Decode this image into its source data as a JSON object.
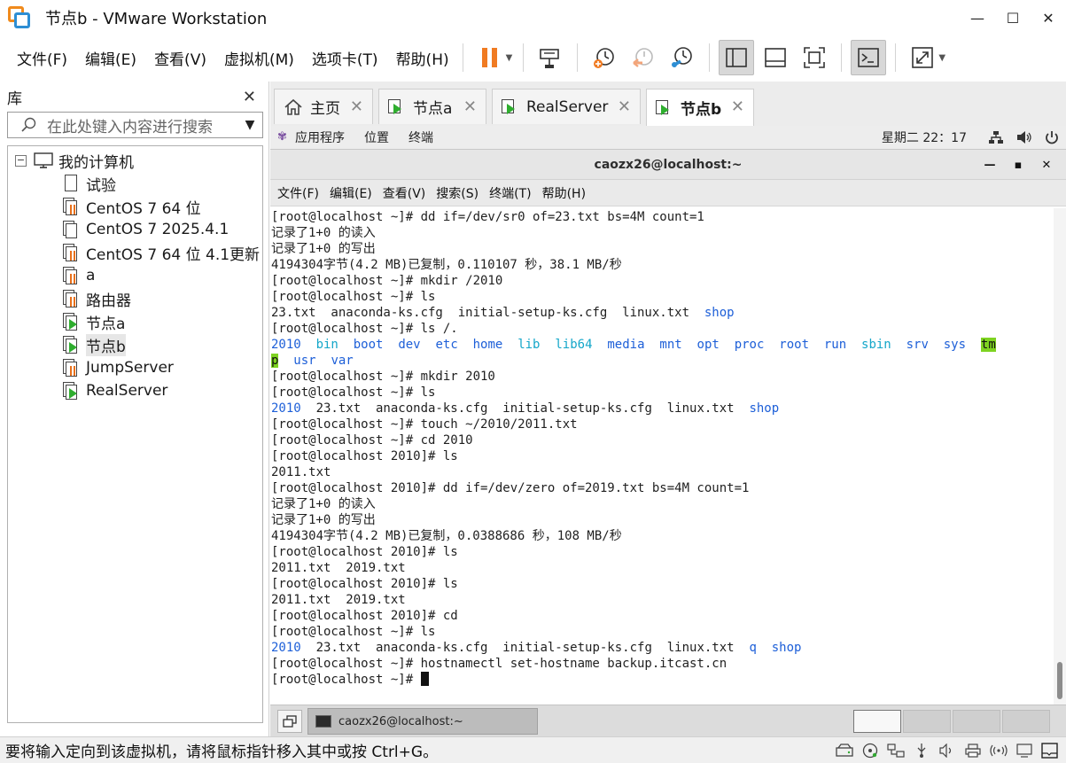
{
  "window": {
    "title": "节点b - VMware Workstation"
  },
  "menu": [
    "文件(F)",
    "编辑(E)",
    "查看(V)",
    "虚拟机(M)",
    "选项卡(T)",
    "帮助(H)"
  ],
  "library": {
    "title": "库",
    "search_placeholder": "在此处键入内容进行搜索",
    "root": "我的计算机",
    "items": [
      {
        "label": "试验",
        "icon": "document-icon"
      },
      {
        "label": "CentOS 7 64 位",
        "icon": "vm-suspended-icon"
      },
      {
        "label": "CentOS 7 2025.4.1",
        "icon": "vm-icon"
      },
      {
        "label": "CentOS 7 64 位 4.1更新",
        "icon": "vm-suspended-icon"
      },
      {
        "label": "a",
        "icon": "vm-suspended-icon"
      },
      {
        "label": "路由器",
        "icon": "vm-suspended-icon"
      },
      {
        "label": "节点a",
        "icon": "vm-running-icon"
      },
      {
        "label": "节点b",
        "icon": "vm-running-icon",
        "selected": true
      },
      {
        "label": "JumpServer",
        "icon": "vm-suspended-icon"
      },
      {
        "label": "RealServer",
        "icon": "vm-running-icon"
      }
    ]
  },
  "tabs": [
    {
      "label": "主页",
      "icon": "home-icon"
    },
    {
      "label": "节点a",
      "icon": "vm-running-icon"
    },
    {
      "label": "RealServer",
      "icon": "vm-running-icon"
    },
    {
      "label": "节点b",
      "icon": "vm-running-icon",
      "active": true
    }
  ],
  "gnome": {
    "apps": "应用程序",
    "places": "位置",
    "terminal": "终端",
    "clock": "星期二 22：17"
  },
  "terminal": {
    "title": "caozx26@localhost:~",
    "menu": [
      "文件(F)",
      "编辑(E)",
      "查看(V)",
      "搜索(S)",
      "终端(T)",
      "帮助(H)"
    ],
    "lines": [
      [
        {
          "t": "[root@localhost ~]# dd if=/dev/sr0 of=23.txt bs=4M count=1"
        }
      ],
      [
        {
          "t": "记录了1+0 的读入"
        }
      ],
      [
        {
          "t": "记录了1+0 的写出"
        }
      ],
      [
        {
          "t": "4194304字节(4.2 MB)已复制，0.110107 秒，38.1 MB/秒"
        }
      ],
      [
        {
          "t": "[root@localhost ~]# mkdir /2010"
        }
      ],
      [
        {
          "t": "[root@localhost ~]# ls"
        }
      ],
      [
        {
          "t": "23.txt  anaconda-ks.cfg  initial-setup-ks.cfg  linux.txt  "
        },
        {
          "t": "shop",
          "c": "blue"
        }
      ],
      [
        {
          "t": "[root@localhost ~]# ls /."
        }
      ],
      [
        {
          "t": "2010",
          "c": "blue"
        },
        {
          "t": "  "
        },
        {
          "t": "bin",
          "c": "cyan"
        },
        {
          "t": "  "
        },
        {
          "t": "boot",
          "c": "blue"
        },
        {
          "t": "  "
        },
        {
          "t": "dev",
          "c": "blue"
        },
        {
          "t": "  "
        },
        {
          "t": "etc",
          "c": "blue"
        },
        {
          "t": "  "
        },
        {
          "t": "home",
          "c": "blue"
        },
        {
          "t": "  "
        },
        {
          "t": "lib",
          "c": "cyan"
        },
        {
          "t": "  "
        },
        {
          "t": "lib64",
          "c": "cyan"
        },
        {
          "t": "  "
        },
        {
          "t": "media",
          "c": "blue"
        },
        {
          "t": "  "
        },
        {
          "t": "mnt",
          "c": "blue"
        },
        {
          "t": "  "
        },
        {
          "t": "opt",
          "c": "blue"
        },
        {
          "t": "  "
        },
        {
          "t": "proc",
          "c": "blue"
        },
        {
          "t": "  "
        },
        {
          "t": "root",
          "c": "blue"
        },
        {
          "t": "  "
        },
        {
          "t": "run",
          "c": "blue"
        },
        {
          "t": "  "
        },
        {
          "t": "sbin",
          "c": "cyan"
        },
        {
          "t": "  "
        },
        {
          "t": "srv",
          "c": "blue"
        },
        {
          "t": "  "
        },
        {
          "t": "sys",
          "c": "blue"
        },
        {
          "t": "  "
        },
        {
          "t": "tm",
          "c": "hl"
        }
      ],
      [
        {
          "t": "p",
          "c": "hl"
        },
        {
          "t": "  "
        },
        {
          "t": "usr",
          "c": "blue"
        },
        {
          "t": "  "
        },
        {
          "t": "var",
          "c": "blue"
        }
      ],
      [
        {
          "t": "[root@localhost ~]# mkdir 2010"
        }
      ],
      [
        {
          "t": "[root@localhost ~]# ls"
        }
      ],
      [
        {
          "t": "2010",
          "c": "blue"
        },
        {
          "t": "  23.txt  anaconda-ks.cfg  initial-setup-ks.cfg  linux.txt  "
        },
        {
          "t": "shop",
          "c": "blue"
        }
      ],
      [
        {
          "t": "[root@localhost ~]# touch ~/2010/2011.txt"
        }
      ],
      [
        {
          "t": "[root@localhost ~]# cd 2010"
        }
      ],
      [
        {
          "t": "[root@localhost 2010]# ls"
        }
      ],
      [
        {
          "t": "2011.txt"
        }
      ],
      [
        {
          "t": "[root@localhost 2010]# dd if=/dev/zero of=2019.txt bs=4M count=1"
        }
      ],
      [
        {
          "t": "记录了1+0 的读入"
        }
      ],
      [
        {
          "t": "记录了1+0 的写出"
        }
      ],
      [
        {
          "t": "4194304字节(4.2 MB)已复制，0.0388686 秒，108 MB/秒"
        }
      ],
      [
        {
          "t": "[root@localhost 2010]# ls"
        }
      ],
      [
        {
          "t": "2011.txt  2019.txt"
        }
      ],
      [
        {
          "t": "[root@localhost 2010]# ls"
        }
      ],
      [
        {
          "t": "2011.txt  2019.txt"
        }
      ],
      [
        {
          "t": "[root@localhost 2010]# cd"
        }
      ],
      [
        {
          "t": "[root@localhost ~]# ls"
        }
      ],
      [
        {
          "t": "2010",
          "c": "blue"
        },
        {
          "t": "  23.txt  anaconda-ks.cfg  initial-setup-ks.cfg  linux.txt  "
        },
        {
          "t": "q",
          "c": "blue"
        },
        {
          "t": "  "
        },
        {
          "t": "shop",
          "c": "blue"
        }
      ],
      [
        {
          "t": "[root@localhost ~]# hostnamectl set-hostname backup.itcast.cn"
        }
      ],
      [
        {
          "t": "[root@localhost ~]# "
        },
        {
          "t": "",
          "c": "cursor"
        }
      ]
    ]
  },
  "taskbar": {
    "task_label": "caozx26@localhost:~"
  },
  "status": {
    "text": "要将输入定向到该虚拟机，请将鼠标指针移入其中或按 Ctrl+G。"
  },
  "colors": {
    "blue": "#1d5fd8",
    "cyan": "#13a6c9",
    "highlight": "#7ed321",
    "pause_orange": "#f07b22"
  }
}
